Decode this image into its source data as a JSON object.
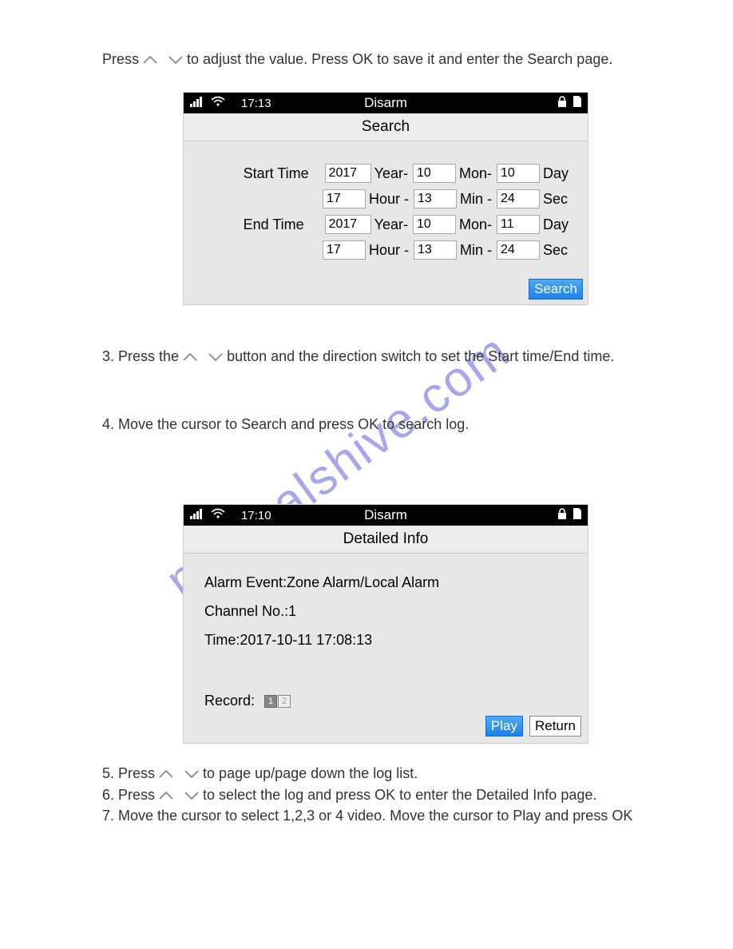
{
  "line1_prefix": "Press ",
  "line1_suffix": " to adjust the value. Press OK to save it and enter the Search page.",
  "screen1": {
    "status": {
      "time": "17:13",
      "title": "Disarm"
    },
    "title": "Search",
    "labels": {
      "start": "Start Time",
      "end": "End Time",
      "year": "Year-",
      "mon": "Mon-",
      "day": "Day",
      "hour": "Hour -",
      "min": "Min -",
      "sec": "Sec"
    },
    "start": {
      "year": "2017",
      "mon": "10",
      "day": "10",
      "hour": "17",
      "min": "13",
      "sec": "24"
    },
    "end": {
      "year": "2017",
      "mon": "10",
      "day": "11",
      "hour": "17",
      "min": "13",
      "sec": "24"
    },
    "search_btn": "Search"
  },
  "line2_prefix": "3. Press the ",
  "line2_suffix": " button and the direction switch to set the Start time/End time.",
  "line3": "4. Move the cursor to Search and press OK to search log.",
  "screen2": {
    "status": {
      "time": "17:10",
      "title": "Disarm"
    },
    "title": "Detailed Info",
    "alarm_label": "Alarm Event:",
    "alarm_value": "Zone Alarm/Local Alarm",
    "channel_label": "Channel No.:",
    "channel_value": "1",
    "time_label": "Time:",
    "time_value": "2017-10-11 17:08:13",
    "record_label": "Record:",
    "rec1": "1",
    "rec2": "2",
    "play_btn": "Play",
    "return_btn": "Return"
  },
  "line4_prefix": "5. Press ",
  "line4_suffix": " to page up/page down the log list.",
  "line5_prefix": "6. Press ",
  "line5_suffix": " to select the log and press OK to enter the Detailed Info page.",
  "line6": "7. Move the cursor to select 1,2,3 or 4 video. Move the cursor to Play and press OK",
  "watermark": "manualshive.com"
}
